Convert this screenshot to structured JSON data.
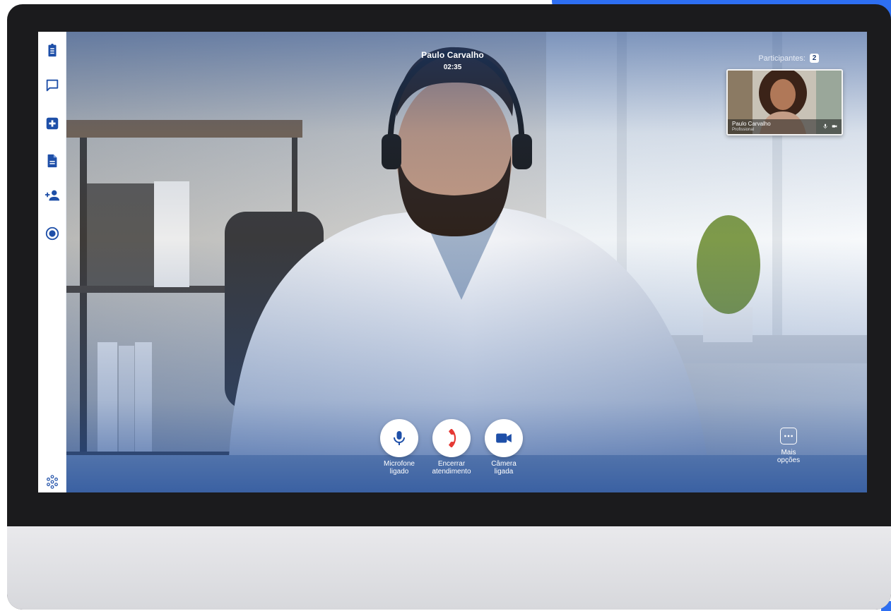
{
  "call": {
    "caller_name": "Paulo Carvalho",
    "timer": "02:35"
  },
  "participants": {
    "label": "Participantes:",
    "count": "2"
  },
  "self_view": {
    "name": "Paulo Carvalho",
    "role": "Profissional"
  },
  "controls": {
    "mic_label": "Microfone\nligado",
    "end_label": "Encerrar\natendimento",
    "camera_label": "Câmera\nligada",
    "more_label": "Mais\nopções"
  },
  "sidebar": {
    "items": [
      "clipboard-icon",
      "chat-icon",
      "medical-plus-icon",
      "document-icon",
      "add-person-icon",
      "record-icon",
      "apps-icon"
    ]
  },
  "colors": {
    "accent": "#1e4fa8",
    "end_call": "#e53935",
    "brand_blue": "#2e6ff2"
  }
}
